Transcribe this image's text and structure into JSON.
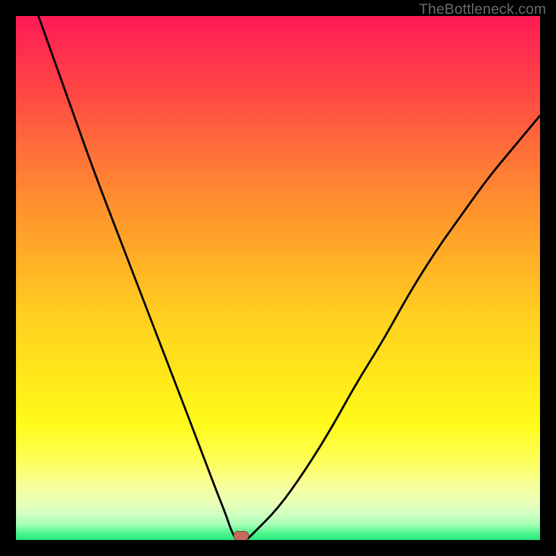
{
  "watermark": "TheBottleneck.com",
  "chart_data": {
    "type": "line",
    "title": "",
    "xlabel": "",
    "ylabel": "",
    "x": [
      0,
      5,
      10,
      15,
      20,
      25,
      30,
      35,
      38,
      40,
      41,
      42,
      43,
      44,
      45,
      50,
      55,
      60,
      65,
      70,
      75,
      80,
      85,
      90,
      95,
      100
    ],
    "values": [
      112,
      98,
      84,
      70,
      57,
      44,
      31,
      18,
      10,
      5,
      2,
      0,
      0,
      0,
      1,
      6,
      13,
      21,
      30,
      38,
      47,
      55,
      62,
      69,
      75,
      81
    ],
    "xlim": [
      0,
      100
    ],
    "ylim": [
      0,
      100
    ],
    "min_marker_x_percent": 43,
    "gradient": {
      "top": "#ff1a55",
      "bottom": "#25e87d"
    }
  }
}
